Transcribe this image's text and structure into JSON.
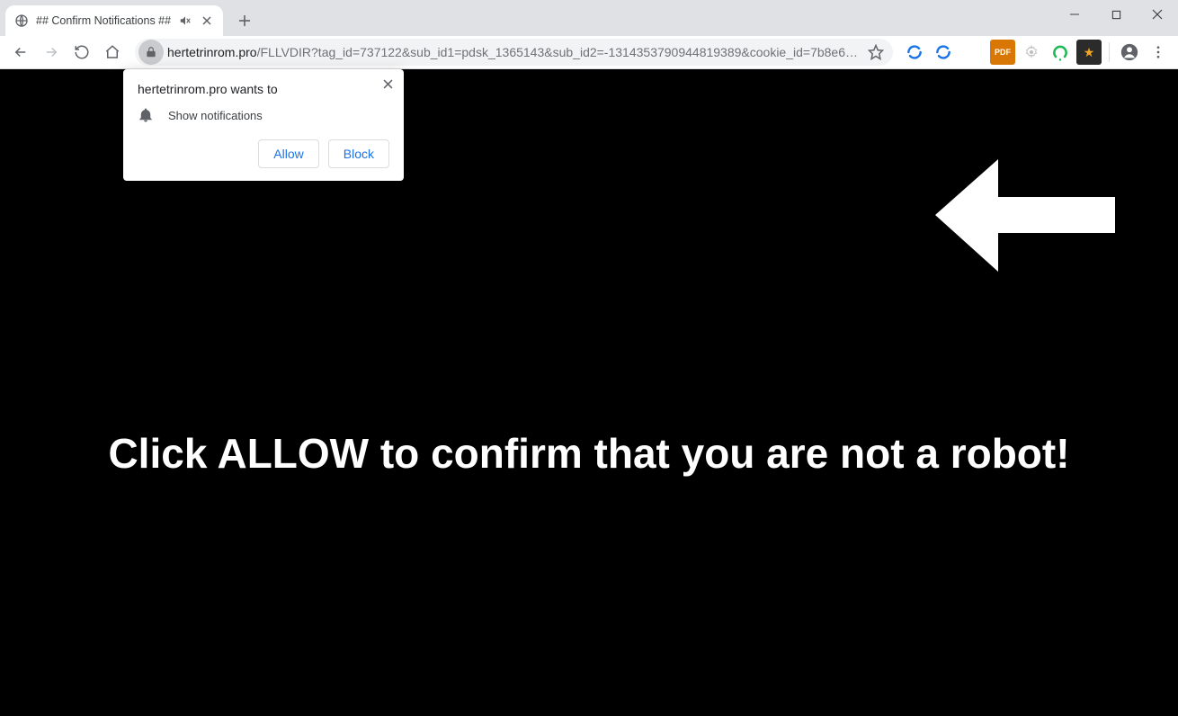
{
  "window": {
    "tab_title": "## Confirm Notifications ##"
  },
  "address": {
    "host": "hertetrinrom.pro",
    "path": "/FLLVDIR?tag_id=737122&sub_id1=pdsk_1365143&sub_id2=-1314353790944819389&cookie_id=7b8e68c4-4bf3-..."
  },
  "prompt": {
    "origin_text": "hertetrinrom.pro wants to",
    "permission_text": "Show notifications",
    "allow_label": "Allow",
    "block_label": "Block"
  },
  "page": {
    "headline": "Click ALLOW to confirm that you are not a robot!"
  },
  "icons": {
    "ext1_label": "PDF",
    "ext4_glyph": "★"
  }
}
